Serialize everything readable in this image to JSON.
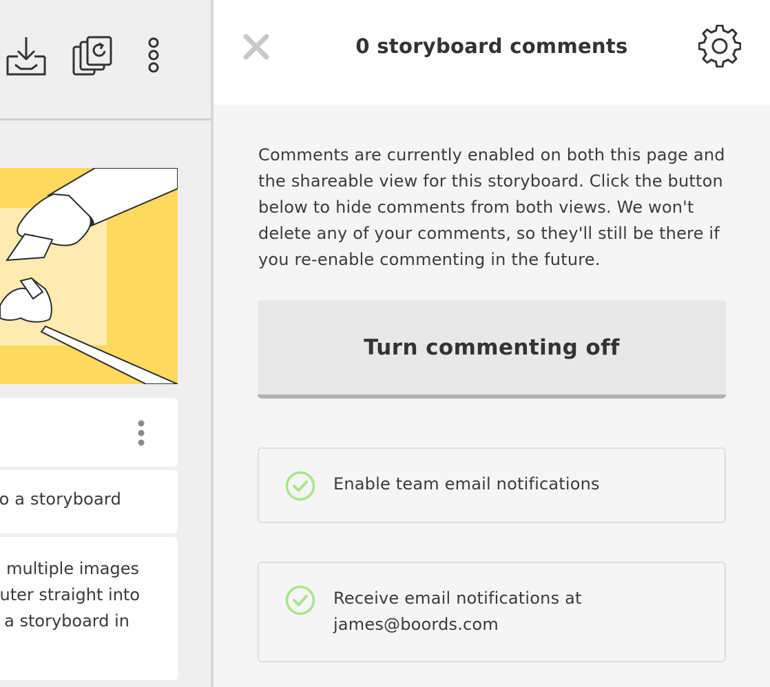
{
  "left_pane": {
    "toolbar": {
      "icons": [
        "download-icon",
        "duplicate-icon",
        "more-vertical-icon"
      ]
    },
    "frame_card": {
      "title": "o a storyboard",
      "description_lines": [
        "multiple images",
        "uter straight into",
        "a storyboard in"
      ]
    }
  },
  "panel": {
    "title": "0 storyboard comments",
    "info_text": "Comments are currently enabled on both this page and the shareable view for this storyboard. Click the button below to hide comments from both views. We won't delete any of your comments, so they'll still be there if you re-enable commenting in the future.",
    "toggle_button_label": "Turn commenting off",
    "options": [
      {
        "label": "Enable team email notifications",
        "checked": true
      },
      {
        "label_line1": "Receive email notifications at",
        "label_line2": "james@boords.com",
        "checked": true
      }
    ]
  },
  "colors": {
    "frame_yellow": "#ffd95e",
    "frame_yellow_light": "#ffeab0",
    "check_green": "#a8e58a"
  }
}
